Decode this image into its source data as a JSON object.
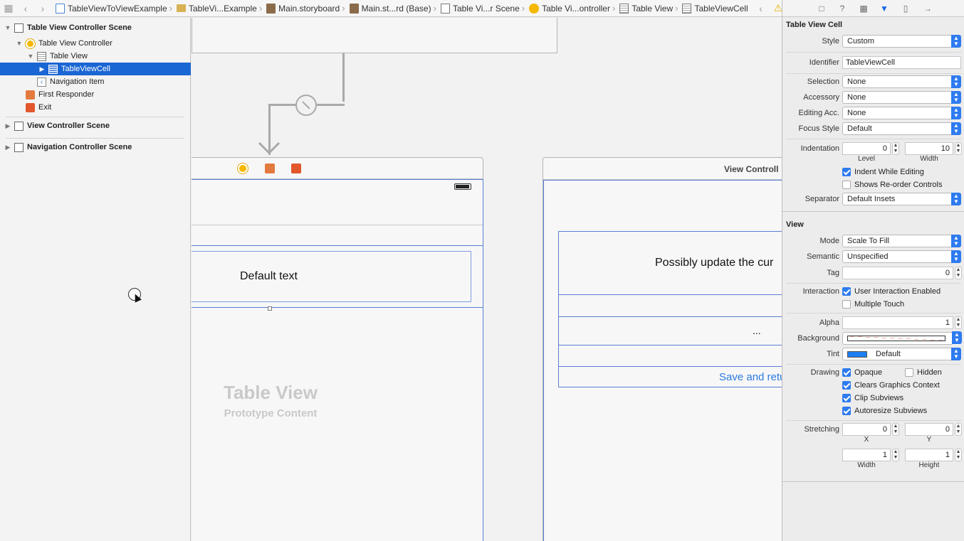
{
  "jumpbar": {
    "crumbs": [
      {
        "label": "TableViewToViewExample",
        "icon": "swift-file-icon"
      },
      {
        "label": "TableVi...Example",
        "icon": "folder-icon"
      },
      {
        "label": "Main.storyboard",
        "icon": "storyboard-icon"
      },
      {
        "label": "Main.st...rd (Base)",
        "icon": "storyboard-icon"
      },
      {
        "label": "Table Vi...r Scene",
        "icon": "scene-icon"
      },
      {
        "label": "Table Vi...ontroller",
        "icon": "view-controller-icon"
      },
      {
        "label": "Table View",
        "icon": "table-view-icon"
      },
      {
        "label": "TableViewCell",
        "icon": "table-view-icon"
      }
    ]
  },
  "outline": {
    "items": [
      {
        "label": "Table View Controller Scene",
        "bold": true
      },
      {
        "label": "Table View Controller"
      },
      {
        "label": "Table View"
      },
      {
        "label": "TableViewCell",
        "selected": true
      },
      {
        "label": "Navigation Item"
      },
      {
        "label": "First Responder"
      },
      {
        "label": "Exit"
      },
      {
        "label": "View Controller Scene",
        "bold": true
      },
      {
        "label": "Navigation Controller Scene",
        "bold": true
      }
    ]
  },
  "canvas": {
    "cell_text": "Default text",
    "placeholder_title": "Table View",
    "placeholder_subtitle": "Prototype Content",
    "scene2_title": "View Controll",
    "label_text": "Possibly update the cur",
    "dots_text": "...",
    "button_text": "Save and retu"
  },
  "inspector": {
    "section_cell": "Table View Cell",
    "style_label": "Style",
    "style_value": "Custom",
    "identifier_label": "Identifier",
    "identifier_value": "TableViewCell",
    "selection_label": "Selection",
    "selection_value": "None",
    "accessory_label": "Accessory",
    "accessory_value": "None",
    "editing_acc_label": "Editing Acc.",
    "editing_acc_value": "None",
    "focus_style_label": "Focus Style",
    "focus_style_value": "Default",
    "indentation_label": "Indentation",
    "indentation_level": "0",
    "indentation_width": "10",
    "level_label": "Level",
    "width_label": "Width",
    "indent_while_editing": "Indent While Editing",
    "shows_reorder": "Shows Re-order Controls",
    "separator_label": "Separator",
    "separator_value": "Default Insets",
    "section_view": "View",
    "mode_label": "Mode",
    "mode_value": "Scale To Fill",
    "semantic_label": "Semantic",
    "semantic_value": "Unspecified",
    "tag_label": "Tag",
    "tag_value": "0",
    "interaction_label": "Interaction",
    "user_interaction": "User Interaction Enabled",
    "multiple_touch": "Multiple Touch",
    "alpha_label": "Alpha",
    "alpha_value": "1",
    "background_label": "Background",
    "tint_label": "Tint",
    "tint_value": "Default",
    "tint_color": "#1e7ff0",
    "drawing_label": "Drawing",
    "opaque": "Opaque",
    "hidden": "Hidden",
    "clears_graphics": "Clears Graphics Context",
    "clip_subviews": "Clip Subviews",
    "autoresize_subviews": "Autoresize Subviews",
    "stretching_label": "Stretching",
    "stretch_x": "0",
    "stretch_y": "0",
    "x_label": "X",
    "y_label": "Y",
    "stretch_width": "1",
    "stretch_height": "1",
    "height_label": "Height"
  },
  "colors": {
    "selection": "#1a66d4",
    "accent": "#2e7bef",
    "button_text": "#2a7ae2"
  }
}
